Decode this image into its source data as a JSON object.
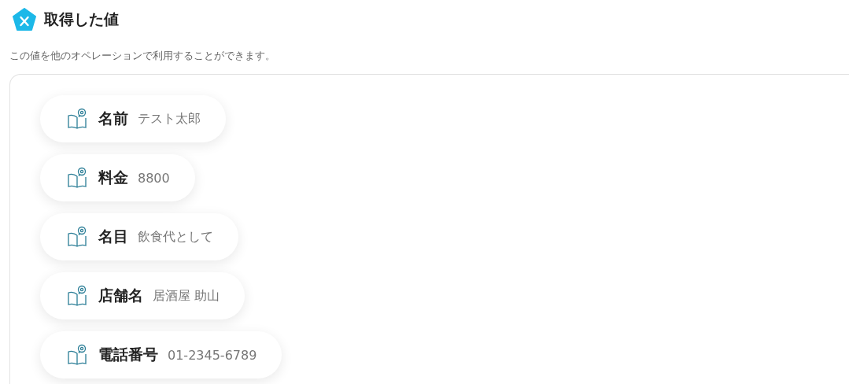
{
  "header": {
    "title": "取得した値",
    "description": "この値を他のオペレーションで利用することができます。"
  },
  "values": [
    {
      "label": "名前",
      "value": "テスト太郎"
    },
    {
      "label": "料金",
      "value": "8800"
    },
    {
      "label": "名目",
      "value": "飲食代として"
    },
    {
      "label": "店舗名",
      "value": "居酒屋 助山"
    },
    {
      "label": "電話番号",
      "value": "01-2345-6789"
    }
  ]
}
